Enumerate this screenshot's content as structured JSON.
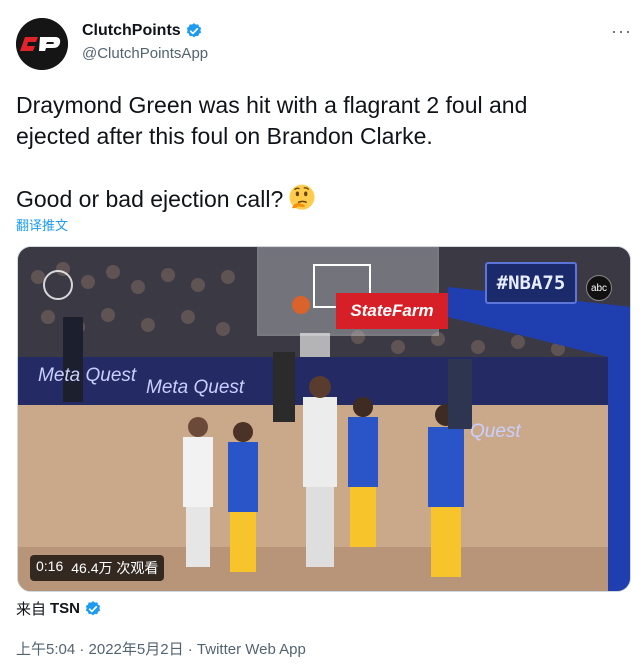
{
  "author": {
    "display_name": "ClutchPoints",
    "handle": "@ClutchPointsApp",
    "avatar_text": "CP",
    "verified": true
  },
  "tweet": {
    "line1": "Draymond Green was hit with a flagrant 2 foul and",
    "line2": "ejected after this foul on Brandon Clarke.",
    "line3": "Good or bad ejection call?",
    "emoji": "thinking-face",
    "translate_label": "翻译推文"
  },
  "media": {
    "duration": "0:16",
    "views": "46.4万 次观看",
    "scorebug": "#NBA75",
    "network": "abc",
    "sponsor": "StateFarm",
    "ads": [
      "Meta Quest",
      "Meta Quest",
      "Quest"
    ]
  },
  "source": {
    "prefix": "来自",
    "name": "TSN",
    "verified": true
  },
  "meta": {
    "timestamp": "上午5:04 · 2022年5月2日 · Twitter Web App"
  },
  "colors": {
    "accent": "#1d9bf0",
    "text": "#0f1419",
    "secondary": "#536471",
    "avatar_red": "#e0242a"
  }
}
